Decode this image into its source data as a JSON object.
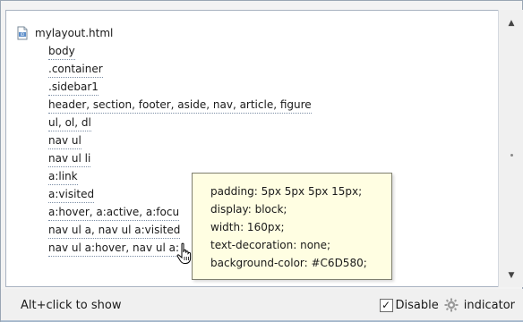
{
  "tree": {
    "file_name": "mylayout.html",
    "rules": [
      "body",
      ".container",
      ".sidebar1",
      "header, section, footer, aside, nav, article, figure",
      "ul, ol, dl",
      "nav ul",
      "nav ul li",
      "a:link",
      "a:visited",
      "a:hover, a:active, a:focu",
      "nav ul a, nav ul a:visited",
      "nav ul a:hover, nav ul a:"
    ]
  },
  "tooltip": {
    "lines": [
      "padding: 5px 5px 5px 15px;",
      "display: block;",
      "width: 160px;",
      "text-decoration: none;",
      "background-color: #C6D580;"
    ]
  },
  "statusbar": {
    "hint": "Alt+click to show",
    "disable_checked": true,
    "disable_label": "Disable",
    "indicator_label": "indicator"
  },
  "icons": {
    "file": "html-file-icon",
    "gear": "gear-indicator-icon",
    "cursor": "hand-pointer-cursor-icon",
    "scroll_up": "scroll-up-arrow-icon",
    "scroll_down": "scroll-down-arrow-icon"
  },
  "colors": {
    "tooltip_bg": "#fffee2",
    "panel_bg": "#ffffff",
    "dotted_underline": "#7d8fa6"
  }
}
